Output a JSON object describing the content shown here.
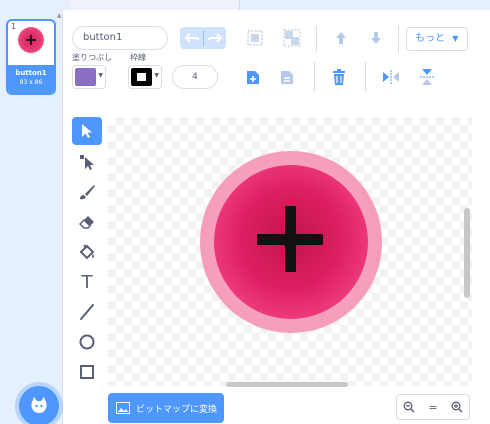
{
  "costume_list": {
    "items": [
      {
        "number": "1",
        "name": "button1",
        "size": "83 x 86"
      }
    ]
  },
  "toolbar": {
    "costume_name": "button1",
    "more_label": "もっと",
    "fill_label": "塗りつぶし",
    "outline_label": "枠線",
    "outline_width": "4"
  },
  "colors": {
    "accent": "#4d97ff",
    "fill_color": "#8b6fc4",
    "outline_color": "#000000",
    "button_pink": "#e83d7a"
  },
  "tools": [
    {
      "name": "select",
      "icon": "arrow-icon",
      "active": true
    },
    {
      "name": "reshape",
      "icon": "reshape-icon",
      "active": false
    },
    {
      "name": "brush",
      "icon": "brush-icon",
      "active": false
    },
    {
      "name": "eraser",
      "icon": "eraser-icon",
      "active": false
    },
    {
      "name": "fill",
      "icon": "bucket-icon",
      "active": false
    },
    {
      "name": "text",
      "icon": "text-icon",
      "active": false,
      "glyph": "T"
    },
    {
      "name": "line",
      "icon": "line-icon",
      "active": false
    },
    {
      "name": "circle",
      "icon": "circle-icon",
      "active": false
    },
    {
      "name": "rectangle",
      "icon": "rectangle-icon",
      "active": false
    }
  ],
  "bottom": {
    "convert_label": "ビットマップに変換",
    "zoom_reset": "="
  }
}
